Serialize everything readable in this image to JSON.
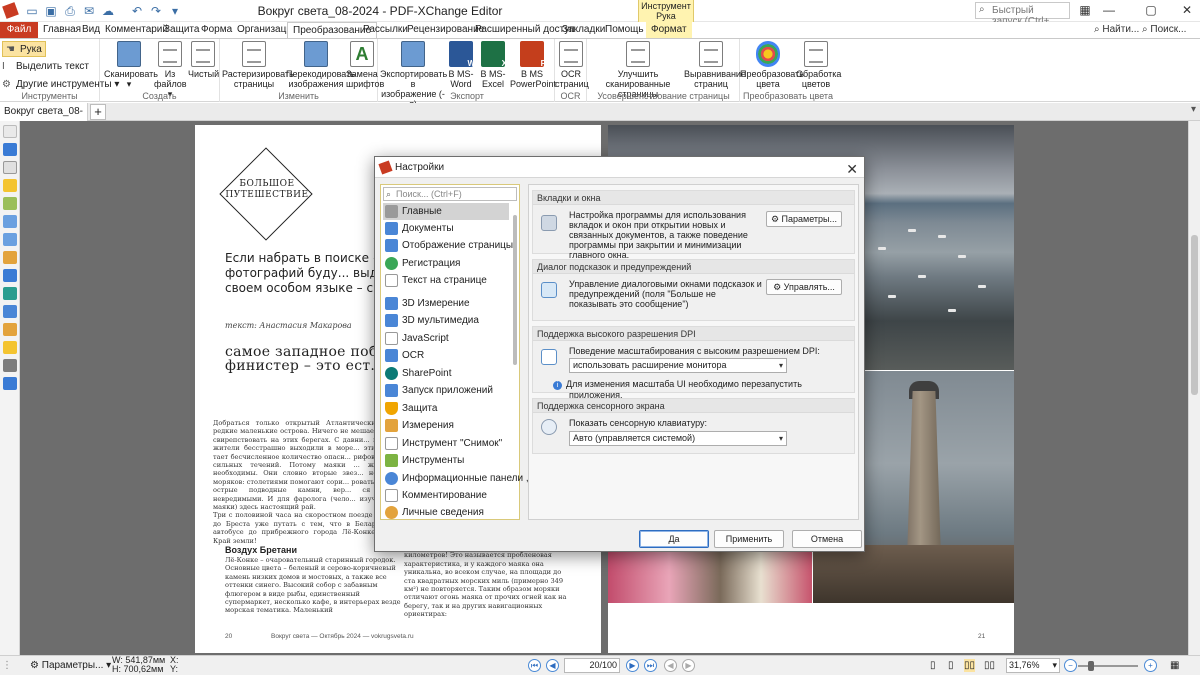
{
  "window": {
    "title": "Вокруг света_08-2024 - PDF-XChange Editor",
    "context_tab_group": "Инструмент Рука",
    "quick_launch_placeholder": "Быстрый запуск (Ctrl+...",
    "find_label": "Найти...",
    "search_label": "Поиск..."
  },
  "ribbon_tabs": [
    "Файл",
    "Главная",
    "Вид",
    "Комментарий",
    "Защита",
    "Форма",
    "Организация",
    "Преобразование",
    "Рассылки",
    "Рецензирование",
    "Расширенный доступ",
    "Закладки",
    "Помощь",
    "Формат"
  ],
  "active_tab": "Преобразование",
  "tools": {
    "hand": "Рука",
    "select_text": "Выделить текст",
    "other_tools": "Другие инструменты",
    "group_label": "Инструменты"
  },
  "groups": {
    "create": "Создать",
    "modify": "Изменить",
    "export": "Экспорт",
    "ocr": "OCR",
    "enhance": "Усовершенствование страницы",
    "color": "Преобразовать цвета"
  },
  "buttons": {
    "scan": "Сканировать",
    "from_files_1": "Из",
    "from_files_2": "файлов",
    "blank": "Чистый",
    "rasterize_1": "Растеризировать",
    "rasterize_2": "страницы",
    "recode_1": "Перекодировать",
    "recode_2": "изображения",
    "replace_fonts_1": "Замена",
    "replace_fonts_2": "шрифтов",
    "export_img_1": "Экспортировать в",
    "export_img_2": "изображение (-я)",
    "word_1": "В MS-",
    "word_2": "Word",
    "excel_1": "В MS-",
    "excel_2": "Excel",
    "ppt_1": "В MS",
    "ppt_2": "PowerPoint",
    "ocr_1": "OCR",
    "ocr_2": "страниц",
    "improve_1": "Улучшить",
    "improve_2": "сканированные страницы",
    "align_1": "Выравнивание",
    "align_2": "страниц",
    "convert_colors_1": "Преобразовать",
    "convert_colors_2": "цвета",
    "process_colors_1": "Обработка",
    "process_colors_2": "цветов"
  },
  "document_tab": "Вокруг света_08-2024",
  "page_left": {
    "badge": "БОЛЬШОЕ ПУТЕШЕСТВИЕ",
    "lead": "Если набрать в поиске «маяки в ц... захватывающих фотографий буду... выдерживают натиск стихии, под... на своем особом языке – света и...",
    "author_prefix": "текст:",
    "author": "Анастасия Макарова",
    "headline": "самое западное побережье бретан... называется финистер – это ест... край земли.",
    "body": "Добраться только открытый Атлантический ... и редкие маленькие острова. Ничего не мешает ... мам свирепствовать на этих берегах. С давни... местные жители бесстрашно выходили в море... этих водах тает бесчисленное количество опасн... рифов, мелей, сильных течений. Потому маяки ... жизненно необходимы. Они словно вторые звез... небо для моряков: столетиями помогают сори... ровать, обойти острые подводные камни, вер... ся домой невредимыми. И для фаролога (чело... изучающего маяки) здесь настоящий рай.",
    "body_b": "Три с половиной часа на скоростном поезде ... рижа до Бреста уже путать с тем, что в Беларус... на автобусе до прибрежного города Лё-Конке... он – Край земли!",
    "subhead": "Воздух Бретани",
    "body2": "Лё-Конке – очаровательный старинный городок. Основные цвета – беленый и серово-коричневый камень низких домов и мостовых, а также все оттенки синего. Высокий собор с забавным флюгером в виде рыбы, единственный супермаркет, несколько кафе, в интерьерах везде морская тематика. Маленький",
    "body3": "ка, которую видно на расстоянии до сорока километров! Это называется пробленовая характеристика, и у каждого маяка она уникальна, во всеком случае, на площади до ста квадратных морских миль (примерно 349 км²) не повторяется. Таким образом моряки отличают огонь маяка от прочих огней как на берегу, так и на других навигационных ориентирах:",
    "page_no": "20",
    "footer": "Вокруг света — Октябрь 2024 — vokrugsveta.ru"
  },
  "page_right": {
    "page_no": "21"
  },
  "dialog": {
    "title": "Настройки",
    "search_placeholder": "Поиск... (Ctrl+F)",
    "categories": [
      "Главные",
      "Документы",
      "Отображение страницы",
      "Регистрация",
      "Текст на странице",
      "3D Измерение",
      "3D мультимедиа",
      "JavaScript",
      "OCR",
      "SharePoint",
      "Запуск приложений",
      "Защита",
      "Измерения",
      "Инструмент \"Снимок\"",
      "Инструменты",
      "Информационные панели ,",
      "Комментирование",
      "Личные сведения"
    ],
    "selected_category": "Главные",
    "sections": {
      "tabs": {
        "header": "Вкладки и окна",
        "text": "Настройка программы для использования вкладок и окон при открытии новых и связанных документов, а также поведение программы при закрытии и минимизации главного окна.",
        "button": "Параметры..."
      },
      "hints": {
        "header": "Диалог подсказок и предупреждений",
        "text": "Управление диалоговыми окнами подсказок и предупреждений (поля \"Больше не показывать это сообщение\")",
        "button": "Управлять..."
      },
      "dpi": {
        "header": "Поддержка высокого разрешения DPI",
        "label": "Поведение масштабирования с высоким разрешением DPI:",
        "value": "использовать расширение монитора",
        "note": "Для изменения масштаба UI необходимо перезапустить приложения."
      },
      "touch": {
        "header": "Поддержка сенсорного экрана",
        "label": "Показать сенсорную клавиатуру:",
        "value": "Авто (управляется системой)"
      }
    },
    "ok": "Да",
    "apply": "Применить",
    "cancel": "Отмена"
  },
  "status": {
    "params": "Параметры...",
    "w": "W: 541,87мм",
    "h": "H: 700,62мм",
    "x": "X:",
    "y": "Y:",
    "page_current": "20",
    "page_total": "/100",
    "zoom": "31,76%"
  },
  "colors": {
    "file_tab": "#c93b22",
    "tool_highlight": "#fbe3a1",
    "accent_blue": "#2d6cc0"
  }
}
